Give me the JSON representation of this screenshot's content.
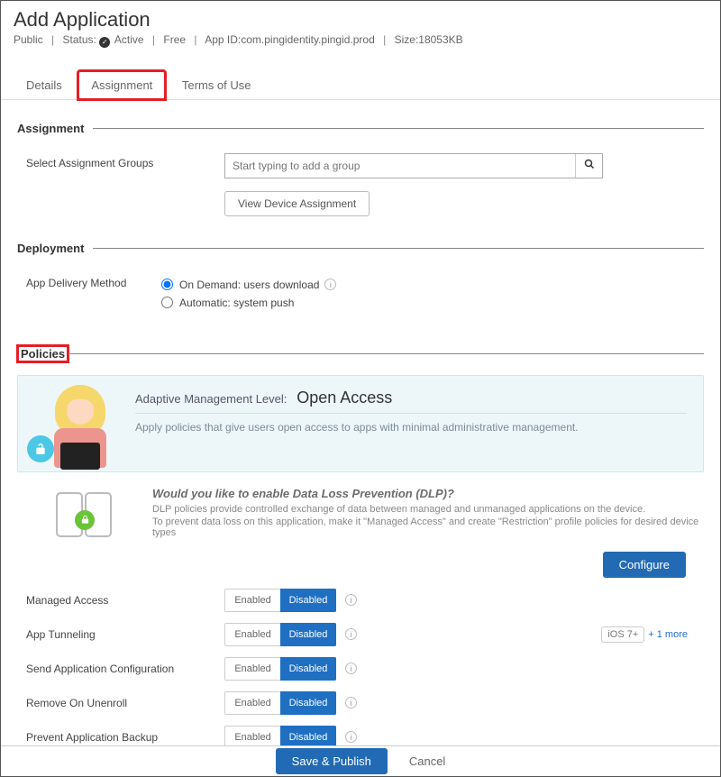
{
  "header": {
    "title": "Add Application",
    "visibility": "Public",
    "status_label": "Status:",
    "status_value": "Active",
    "price": "Free",
    "app_id_label": "App ID:",
    "app_id": "com.pingidentity.pingid.prod",
    "size_label": "Size:",
    "size": "18053KB"
  },
  "tabs": {
    "details": "Details",
    "assignment": "Assignment",
    "terms": "Terms of Use"
  },
  "assignment": {
    "section": "Assignment",
    "select_label": "Select Assignment Groups",
    "placeholder": "Start typing to add a group",
    "view_device_btn": "View Device Assignment"
  },
  "deployment": {
    "section": "Deployment",
    "method_label": "App Delivery Method",
    "opt_on_demand": "On Demand: users download",
    "opt_auto": "Automatic: system push"
  },
  "policies": {
    "section": "Policies",
    "adaptive_label": "Adaptive Management Level:",
    "adaptive_level": "Open Access",
    "adaptive_desc": "Apply policies that give users open access to apps with minimal administrative management.",
    "dlp_title": "Would you like to enable Data Loss Prevention (DLP)?",
    "dlp_line1": "DLP policies provide controlled exchange of data between managed and unmanaged applications on the device.",
    "dlp_line2": "To prevent data loss on this application, make it \"Managed Access\" and create \"Restriction\" profile policies for desired device types",
    "configure_btn": "Configure",
    "enabled": "Enabled",
    "disabled": "Disabled",
    "items": [
      {
        "label": "Managed Access"
      },
      {
        "label": "App Tunneling"
      },
      {
        "label": "Send Application Configuration"
      },
      {
        "label": "Remove On Unenroll"
      },
      {
        "label": "Prevent Application Backup"
      }
    ],
    "os_tag": "iOS 7+",
    "more_link": "+ 1 more"
  },
  "footer": {
    "save": "Save & Publish",
    "cancel": "Cancel"
  }
}
